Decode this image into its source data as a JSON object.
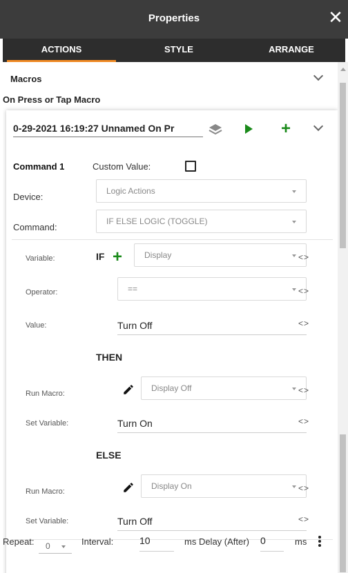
{
  "header": {
    "title": "Properties",
    "close_icon": "close-icon"
  },
  "tabs": [
    {
      "label": "ACTIONS",
      "active": true
    },
    {
      "label": "STYLE",
      "active": false
    },
    {
      "label": "ARRANGE",
      "active": false
    }
  ],
  "macros": {
    "label": "Macros"
  },
  "on_press": {
    "label": "On Press or Tap Macro"
  },
  "macro": {
    "name": "0-29-2021 16:19:27 Unnamed On Pr"
  },
  "command": {
    "title": "Command 1",
    "custom_value_label": "Custom Value:",
    "device_label": "Device:",
    "device_value": "Logic Actions",
    "command_label": "Command:",
    "command_value": "IF ELSE LOGIC (TOGGLE)"
  },
  "if_block": {
    "keyword": "IF",
    "variable_label": "Variable:",
    "variable_value": "Display",
    "operator_label": "Operator:",
    "operator_value": "==",
    "value_label": "Value:",
    "value_value": "Turn Off"
  },
  "then_block": {
    "keyword": "THEN",
    "run_macro_label": "Run Macro:",
    "run_macro_value": "Display Off",
    "set_variable_label": "Set Variable:",
    "set_variable_value": "Turn On"
  },
  "else_block": {
    "keyword": "ELSE",
    "run_macro_label": "Run Macro:",
    "run_macro_value": "Display On",
    "set_variable_label": "Set Variable:",
    "set_variable_value": "Turn Off"
  },
  "footer": {
    "repeat_label": "Repeat:",
    "repeat_value": "0",
    "interval_label": "Interval:",
    "interval_value": "10",
    "delay_label": "ms Delay (After)",
    "delay_value": "0",
    "ms_label": "ms"
  },
  "code_glyph": "<>",
  "colors": {
    "accent": "#f08a24",
    "green": "#1a8a1a",
    "header_bg": "#3c3c3c",
    "tabs_bg": "#2d2d2d"
  }
}
